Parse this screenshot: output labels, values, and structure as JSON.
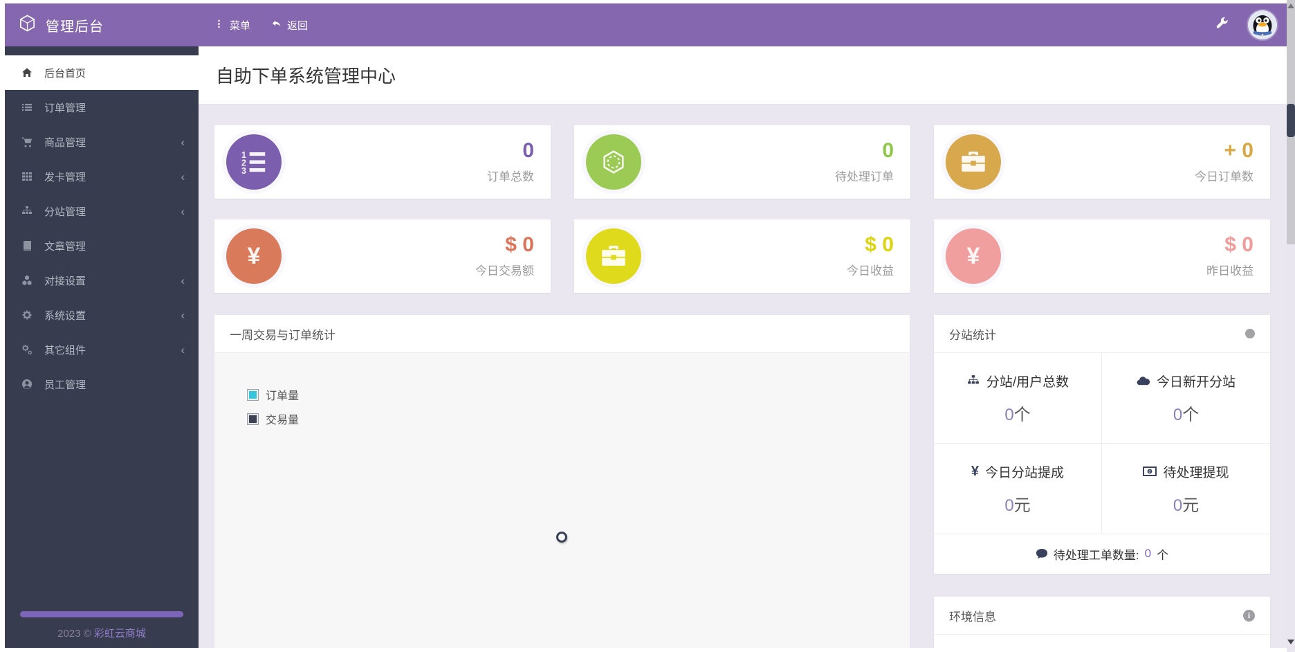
{
  "header": {
    "brand": "管理后台",
    "menu_label": "菜单",
    "back_label": "返回"
  },
  "page": {
    "title": "自助下单系统管理中心"
  },
  "sidebar": {
    "items": [
      {
        "label": "后台首页",
        "icon": "home-icon",
        "active": true,
        "has_submenu": false
      },
      {
        "label": "订单管理",
        "icon": "list-icon",
        "active": false,
        "has_submenu": false
      },
      {
        "label": "商品管理",
        "icon": "cart-icon",
        "active": false,
        "has_submenu": true
      },
      {
        "label": "发卡管理",
        "icon": "grid-icon",
        "active": false,
        "has_submenu": true
      },
      {
        "label": "分站管理",
        "icon": "sitemap-icon",
        "active": false,
        "has_submenu": true
      },
      {
        "label": "文章管理",
        "icon": "book-icon",
        "active": false,
        "has_submenu": false
      },
      {
        "label": "对接设置",
        "icon": "cubes-icon",
        "active": false,
        "has_submenu": true
      },
      {
        "label": "系统设置",
        "icon": "gear-icon",
        "active": false,
        "has_submenu": true
      },
      {
        "label": "其它组件",
        "icon": "gears-icon",
        "active": false,
        "has_submenu": true
      },
      {
        "label": "员工管理",
        "icon": "user-icon",
        "active": false,
        "has_submenu": false
      }
    ],
    "footer": {
      "year": "2023 ©",
      "brand_link": "彩虹云商城"
    }
  },
  "stat_cards": [
    {
      "value": "0",
      "label": "订单总数",
      "icon": "list-ol-icon",
      "circle_color": "#7b5fae",
      "value_color": "#7c60b0"
    },
    {
      "value": "0",
      "label": "待处理订单",
      "icon": "hexagon-icon",
      "circle_color": "#9ccb55",
      "value_color": "#8fc849"
    },
    {
      "value": "+ 0",
      "label": "今日订单数",
      "icon": "briefcase-icon",
      "circle_color": "#d7a84c",
      "value_color": "#d9a843"
    },
    {
      "value": "$ 0",
      "label": "今日交易额",
      "icon": "yen-icon",
      "circle_color": "#d97b5b",
      "value_color": "#da7559"
    },
    {
      "value": "$ 0",
      "label": "今日收益",
      "icon": "briefcase-icon",
      "circle_color": "#e0da1d",
      "value_color": "#ddd411"
    },
    {
      "value": "$ 0",
      "label": "昨日收益",
      "icon": "yen-icon",
      "circle_color": "#f19e9e",
      "value_color": "#f29b9b"
    }
  ],
  "chart_panel": {
    "title": "一周交易与订单统计",
    "legend": [
      {
        "label": "订单量",
        "color": "#38c5dc"
      },
      {
        "label": "交易量",
        "color": "#3a4252"
      }
    ],
    "status": "loading"
  },
  "chart_data": {
    "type": "line",
    "title": "一周交易与订单统计",
    "categories": [],
    "series": [
      {
        "name": "订单量",
        "values": []
      },
      {
        "name": "交易量",
        "values": []
      }
    ],
    "legend_position": "top-left",
    "note": "chart body shows only a loading spinner, no plotted data"
  },
  "branch_stats": {
    "title": "分站统计",
    "cells": [
      {
        "icon": "sitemap-icon",
        "label": "分站/用户总数",
        "value": "0",
        "unit": "个"
      },
      {
        "icon": "cloud-icon",
        "label": "今日新开分站",
        "value": "0",
        "unit": "个"
      },
      {
        "icon": "yen-icon",
        "label": "今日分站提成",
        "value": "0",
        "unit": "元"
      },
      {
        "icon": "money-icon",
        "label": "待处理提现",
        "value": "0",
        "unit": "元"
      }
    ],
    "tickets": {
      "label": "待处理工单数量:",
      "value": "0",
      "unit": "个"
    }
  },
  "env_panel": {
    "title": "环境信息"
  },
  "colors": {
    "header_bg": "#8467ae",
    "sidebar_bg": "#373d4f",
    "body_bg": "#eae7f1",
    "link_purple": "#8f7cc9",
    "legend_cyan": "#38c5dc",
    "legend_dark": "#3a4252"
  }
}
